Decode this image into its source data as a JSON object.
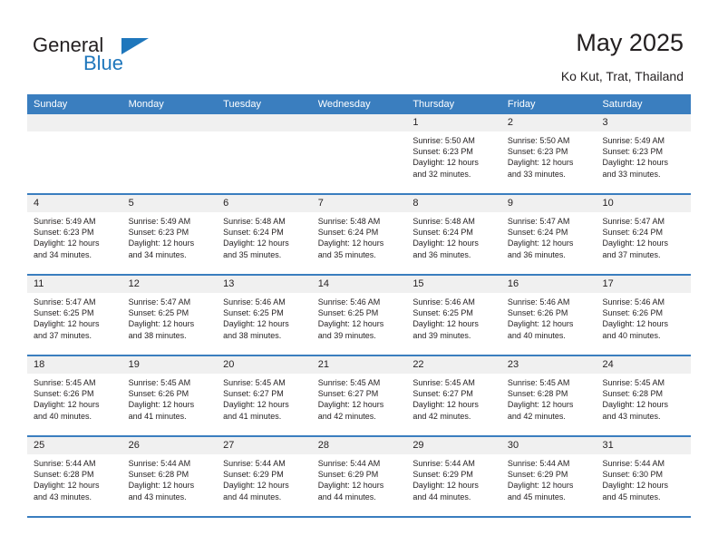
{
  "brand": {
    "name_part1": "General",
    "name_part2": "Blue",
    "accent_color": "#1f77bc"
  },
  "header": {
    "title": "May 2025",
    "subtitle": "Ko Kut, Trat, Thailand"
  },
  "calendar": {
    "header_bg": "#3a7ebf",
    "daynum_bg": "#f0f0f0",
    "day_names": [
      "Sunday",
      "Monday",
      "Tuesday",
      "Wednesday",
      "Thursday",
      "Friday",
      "Saturday"
    ],
    "weeks": [
      [
        {
          "empty": true
        },
        {
          "empty": true
        },
        {
          "empty": true
        },
        {
          "empty": true
        },
        {
          "day": "1",
          "sunrise": "Sunrise: 5:50 AM",
          "sunset": "Sunset: 6:23 PM",
          "daylight_l1": "Daylight: 12 hours",
          "daylight_l2": "and 32 minutes."
        },
        {
          "day": "2",
          "sunrise": "Sunrise: 5:50 AM",
          "sunset": "Sunset: 6:23 PM",
          "daylight_l1": "Daylight: 12 hours",
          "daylight_l2": "and 33 minutes."
        },
        {
          "day": "3",
          "sunrise": "Sunrise: 5:49 AM",
          "sunset": "Sunset: 6:23 PM",
          "daylight_l1": "Daylight: 12 hours",
          "daylight_l2": "and 33 minutes."
        }
      ],
      [
        {
          "day": "4",
          "sunrise": "Sunrise: 5:49 AM",
          "sunset": "Sunset: 6:23 PM",
          "daylight_l1": "Daylight: 12 hours",
          "daylight_l2": "and 34 minutes."
        },
        {
          "day": "5",
          "sunrise": "Sunrise: 5:49 AM",
          "sunset": "Sunset: 6:23 PM",
          "daylight_l1": "Daylight: 12 hours",
          "daylight_l2": "and 34 minutes."
        },
        {
          "day": "6",
          "sunrise": "Sunrise: 5:48 AM",
          "sunset": "Sunset: 6:24 PM",
          "daylight_l1": "Daylight: 12 hours",
          "daylight_l2": "and 35 minutes."
        },
        {
          "day": "7",
          "sunrise": "Sunrise: 5:48 AM",
          "sunset": "Sunset: 6:24 PM",
          "daylight_l1": "Daylight: 12 hours",
          "daylight_l2": "and 35 minutes."
        },
        {
          "day": "8",
          "sunrise": "Sunrise: 5:48 AM",
          "sunset": "Sunset: 6:24 PM",
          "daylight_l1": "Daylight: 12 hours",
          "daylight_l2": "and 36 minutes."
        },
        {
          "day": "9",
          "sunrise": "Sunrise: 5:47 AM",
          "sunset": "Sunset: 6:24 PM",
          "daylight_l1": "Daylight: 12 hours",
          "daylight_l2": "and 36 minutes."
        },
        {
          "day": "10",
          "sunrise": "Sunrise: 5:47 AM",
          "sunset": "Sunset: 6:24 PM",
          "daylight_l1": "Daylight: 12 hours",
          "daylight_l2": "and 37 minutes."
        }
      ],
      [
        {
          "day": "11",
          "sunrise": "Sunrise: 5:47 AM",
          "sunset": "Sunset: 6:25 PM",
          "daylight_l1": "Daylight: 12 hours",
          "daylight_l2": "and 37 minutes."
        },
        {
          "day": "12",
          "sunrise": "Sunrise: 5:47 AM",
          "sunset": "Sunset: 6:25 PM",
          "daylight_l1": "Daylight: 12 hours",
          "daylight_l2": "and 38 minutes."
        },
        {
          "day": "13",
          "sunrise": "Sunrise: 5:46 AM",
          "sunset": "Sunset: 6:25 PM",
          "daylight_l1": "Daylight: 12 hours",
          "daylight_l2": "and 38 minutes."
        },
        {
          "day": "14",
          "sunrise": "Sunrise: 5:46 AM",
          "sunset": "Sunset: 6:25 PM",
          "daylight_l1": "Daylight: 12 hours",
          "daylight_l2": "and 39 minutes."
        },
        {
          "day": "15",
          "sunrise": "Sunrise: 5:46 AM",
          "sunset": "Sunset: 6:25 PM",
          "daylight_l1": "Daylight: 12 hours",
          "daylight_l2": "and 39 minutes."
        },
        {
          "day": "16",
          "sunrise": "Sunrise: 5:46 AM",
          "sunset": "Sunset: 6:26 PM",
          "daylight_l1": "Daylight: 12 hours",
          "daylight_l2": "and 40 minutes."
        },
        {
          "day": "17",
          "sunrise": "Sunrise: 5:46 AM",
          "sunset": "Sunset: 6:26 PM",
          "daylight_l1": "Daylight: 12 hours",
          "daylight_l2": "and 40 minutes."
        }
      ],
      [
        {
          "day": "18",
          "sunrise": "Sunrise: 5:45 AM",
          "sunset": "Sunset: 6:26 PM",
          "daylight_l1": "Daylight: 12 hours",
          "daylight_l2": "and 40 minutes."
        },
        {
          "day": "19",
          "sunrise": "Sunrise: 5:45 AM",
          "sunset": "Sunset: 6:26 PM",
          "daylight_l1": "Daylight: 12 hours",
          "daylight_l2": "and 41 minutes."
        },
        {
          "day": "20",
          "sunrise": "Sunrise: 5:45 AM",
          "sunset": "Sunset: 6:27 PM",
          "daylight_l1": "Daylight: 12 hours",
          "daylight_l2": "and 41 minutes."
        },
        {
          "day": "21",
          "sunrise": "Sunrise: 5:45 AM",
          "sunset": "Sunset: 6:27 PM",
          "daylight_l1": "Daylight: 12 hours",
          "daylight_l2": "and 42 minutes."
        },
        {
          "day": "22",
          "sunrise": "Sunrise: 5:45 AM",
          "sunset": "Sunset: 6:27 PM",
          "daylight_l1": "Daylight: 12 hours",
          "daylight_l2": "and 42 minutes."
        },
        {
          "day": "23",
          "sunrise": "Sunrise: 5:45 AM",
          "sunset": "Sunset: 6:28 PM",
          "daylight_l1": "Daylight: 12 hours",
          "daylight_l2": "and 42 minutes."
        },
        {
          "day": "24",
          "sunrise": "Sunrise: 5:45 AM",
          "sunset": "Sunset: 6:28 PM",
          "daylight_l1": "Daylight: 12 hours",
          "daylight_l2": "and 43 minutes."
        }
      ],
      [
        {
          "day": "25",
          "sunrise": "Sunrise: 5:44 AM",
          "sunset": "Sunset: 6:28 PM",
          "daylight_l1": "Daylight: 12 hours",
          "daylight_l2": "and 43 minutes."
        },
        {
          "day": "26",
          "sunrise": "Sunrise: 5:44 AM",
          "sunset": "Sunset: 6:28 PM",
          "daylight_l1": "Daylight: 12 hours",
          "daylight_l2": "and 43 minutes."
        },
        {
          "day": "27",
          "sunrise": "Sunrise: 5:44 AM",
          "sunset": "Sunset: 6:29 PM",
          "daylight_l1": "Daylight: 12 hours",
          "daylight_l2": "and 44 minutes."
        },
        {
          "day": "28",
          "sunrise": "Sunrise: 5:44 AM",
          "sunset": "Sunset: 6:29 PM",
          "daylight_l1": "Daylight: 12 hours",
          "daylight_l2": "and 44 minutes."
        },
        {
          "day": "29",
          "sunrise": "Sunrise: 5:44 AM",
          "sunset": "Sunset: 6:29 PM",
          "daylight_l1": "Daylight: 12 hours",
          "daylight_l2": "and 44 minutes."
        },
        {
          "day": "30",
          "sunrise": "Sunrise: 5:44 AM",
          "sunset": "Sunset: 6:29 PM",
          "daylight_l1": "Daylight: 12 hours",
          "daylight_l2": "and 45 minutes."
        },
        {
          "day": "31",
          "sunrise": "Sunrise: 5:44 AM",
          "sunset": "Sunset: 6:30 PM",
          "daylight_l1": "Daylight: 12 hours",
          "daylight_l2": "and 45 minutes."
        }
      ]
    ]
  }
}
